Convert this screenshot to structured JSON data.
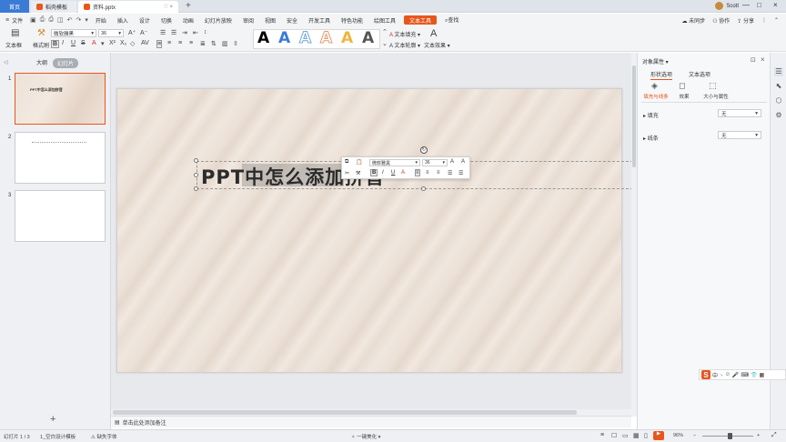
{
  "tabbar": {
    "home": "首页",
    "template": "稻壳模板",
    "doc": "资料.pptx",
    "plus": "+",
    "user": "Scott"
  },
  "menu": {
    "file": "文件",
    "items": [
      "开始",
      "插入",
      "设计",
      "切换",
      "动画",
      "幻灯片放映",
      "审阅",
      "视图",
      "安全",
      "开发工具",
      "特色功能",
      "绘图工具"
    ],
    "active": "文本工具",
    "search": "查找",
    "unsync": "未同步",
    "collab": "协作",
    "share": "分享"
  },
  "ribbon": {
    "textbox": "文本框",
    "painter": "格式刷",
    "font": "微软雅黑",
    "size": "36",
    "fill": "文本填充",
    "outline": "文本轮廓",
    "effect": "文本效果",
    "art": [
      "A",
      "A",
      "A",
      "A",
      "A",
      "A"
    ],
    "art_colors": [
      "#000000",
      "#3a7bd5",
      "#6fa8dc",
      "#e69b6f",
      "#f0b43c",
      "#555555"
    ]
  },
  "leftpanel": {
    "outline": "大纲",
    "slides_tab": "幻灯片",
    "nums": [
      "1",
      "2",
      "3"
    ],
    "thumb_title": "PPT中怎么添加拼音",
    "add": "+"
  },
  "slide": {
    "title": "PPT中怎么添加拼音"
  },
  "minitb": {
    "font": "微软雅黑",
    "size": "36",
    "bold": "B",
    "italic": "I",
    "underline": "U",
    "grow": "A",
    "shrink": "A"
  },
  "rightpanel": {
    "title": "对象属性",
    "tabs": [
      "形状选项",
      "文本选项"
    ],
    "subs": [
      "填充与线条",
      "效果",
      "大小与属性"
    ],
    "fill_label": "填充",
    "fill_value": "无",
    "line_label": "线条",
    "line_value": "无"
  },
  "notes": {
    "placeholder": "单击此处添加备注"
  },
  "status": {
    "slide": "幻灯片 1 / 3",
    "theme": "1_空白设计模板",
    "font_missing": "缺失字体",
    "beautify": "一键美化",
    "zoom": "96%"
  },
  "ime": {
    "s": "S",
    "cn": "中"
  }
}
